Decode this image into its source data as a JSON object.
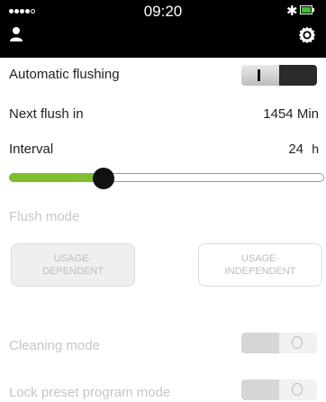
{
  "status_bar": {
    "time": "09:20"
  },
  "settings": {
    "automatic_flushing": {
      "label": "Automatic flushing",
      "toggle_state": "on"
    },
    "next_flush": {
      "label": "Next flush in",
      "value": "1454 Min"
    },
    "interval": {
      "label": "Interval",
      "value": "24",
      "unit": "h",
      "slider_level_percent": 30
    },
    "flush_mode": {
      "label": "Flush mode",
      "options": [
        "USAGE-DEPENDENT",
        "USAGE-INDEPENDENT"
      ],
      "selected": "USAGE-DEPENDENT"
    },
    "cleaning_mode": {
      "label": "Cleaning mode",
      "toggle_state": "off"
    },
    "lock_preset_program_mode": {
      "label": "Lock preset program mode",
      "toggle_state": "off"
    }
  },
  "colors": {
    "accent_green": "#7fbf2f",
    "battery_green": "#3fbf2f",
    "dark": "#000000",
    "disabled_text": "#c6c6c6"
  },
  "icons": [
    "signal-icon",
    "bluetooth-icon",
    "battery-icon",
    "person-icon",
    "gear-icon"
  ]
}
